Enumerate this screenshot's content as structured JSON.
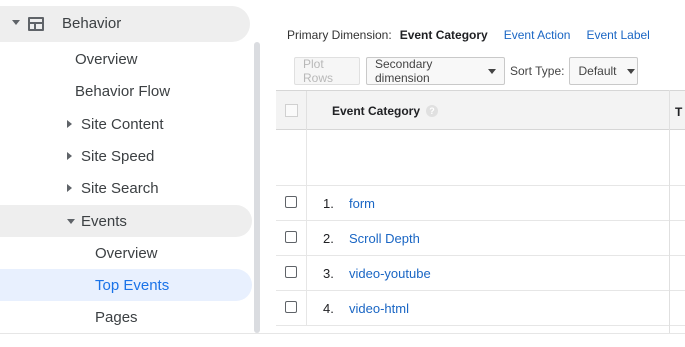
{
  "sidebar": {
    "section_label": "Behavior",
    "items": {
      "overview": "Overview",
      "behavior_flow": "Behavior Flow",
      "site_content": "Site Content",
      "site_speed": "Site Speed",
      "site_search": "Site Search",
      "events": "Events",
      "events_overview": "Overview",
      "top_events": "Top Events",
      "pages": "Pages"
    }
  },
  "dimensions": {
    "label": "Primary Dimension:",
    "active": "Event Category",
    "options": [
      "Event Action",
      "Event Label"
    ]
  },
  "toolbar": {
    "plot_rows": "Plot Rows",
    "secondary_dimension": "Secondary dimension",
    "sort_type_label": "Sort Type:",
    "sort_type_value": "Default"
  },
  "table": {
    "column_header": "Event Category",
    "help_symbol": "?",
    "right_column_header_partial": "T",
    "rows": [
      {
        "num": "1.",
        "name": "form"
      },
      {
        "num": "2.",
        "name": "Scroll Depth"
      },
      {
        "num": "3.",
        "name": "video-youtube"
      },
      {
        "num": "4.",
        "name": "video-html"
      }
    ]
  },
  "colors": {
    "link": "#1a66c4",
    "active_nav_bg": "#e8f0fe",
    "active_nav_text": "#1a73e8",
    "nav_hover_bg": "#eeeeee"
  }
}
